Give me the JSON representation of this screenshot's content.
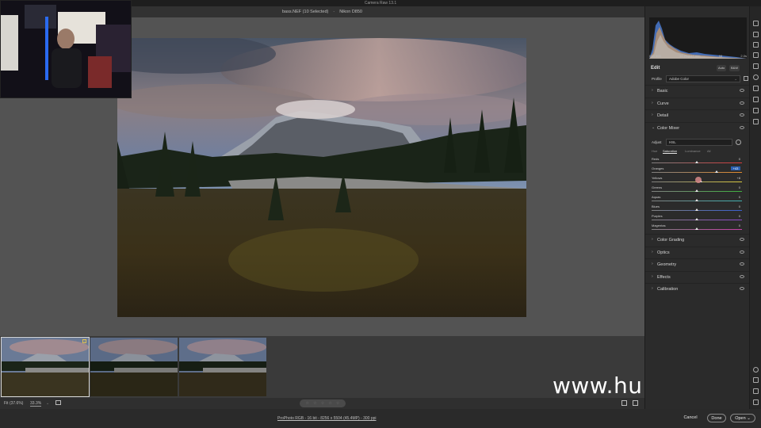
{
  "window": {
    "app_title": "Camera Raw 13.1",
    "file_name": "bass.NEF (10 Selected)",
    "camera": "Nikon D850"
  },
  "camera_info": {
    "iso": "ISO 500",
    "lens": "14-24@17 mm",
    "aperture": "f/8",
    "shutter": "2.0s"
  },
  "edit_panel": {
    "title": "Edit",
    "auto_label": "Auto",
    "bw_label": "B&W",
    "profile_label": "Profile",
    "profile_value": "Adobe Color"
  },
  "sections_top": [
    {
      "label": "Basic"
    },
    {
      "label": "Curve"
    },
    {
      "label": "Detail"
    },
    {
      "label": "Color Mixer"
    }
  ],
  "color_mixer": {
    "adjust_label": "Adjust",
    "adjust_value": "HSL",
    "tabs": [
      "Hue",
      "Saturation",
      "Luminance",
      "All"
    ],
    "active_tab": "Saturation",
    "sliders": [
      {
        "label": "Reds",
        "value": "0",
        "fraction": 0.5,
        "color_left": "#808080",
        "color_right": "#d23a3a"
      },
      {
        "label": "Oranges",
        "value": "+43",
        "fraction": 0.715,
        "color_left": "#808080",
        "color_right": "#e08a30",
        "editing": true
      },
      {
        "label": "Yellows",
        "value": "+8",
        "fraction": 0.54,
        "color_left": "#808080",
        "color_right": "#d8c840"
      },
      {
        "label": "Greens",
        "value": "0",
        "fraction": 0.5,
        "color_left": "#808080",
        "color_right": "#40b040"
      },
      {
        "label": "Aquas",
        "value": "0",
        "fraction": 0.5,
        "color_left": "#808080",
        "color_right": "#40b0b0"
      },
      {
        "label": "Blues",
        "value": "0",
        "fraction": 0.5,
        "color_left": "#808080",
        "color_right": "#3a60d0"
      },
      {
        "label": "Purples",
        "value": "0",
        "fraction": 0.5,
        "color_left": "#808080",
        "color_right": "#8a48c8"
      },
      {
        "label": "Magentas",
        "value": "0",
        "fraction": 0.5,
        "color_left": "#808080",
        "color_right": "#c840a8"
      }
    ]
  },
  "sections_bottom": [
    {
      "label": "Color Grading"
    },
    {
      "label": "Optics"
    },
    {
      "label": "Geometry"
    },
    {
      "label": "Effects"
    },
    {
      "label": "Calibration"
    }
  ],
  "bottom_bar": {
    "fit_label": "Fit (37.6%)",
    "zoom_label": "33.3%",
    "stars": [
      "☆",
      "☆",
      "☆",
      "☆",
      "☆"
    ]
  },
  "footer": {
    "workflow": "ProPhoto RGB - 16 bit - 8256 x 5504 (45.4MP) - 300 ppi",
    "cancel": "Cancel",
    "done": "Done",
    "open": "Open",
    "open_caret": "⌄"
  },
  "watermark": "www.hunls.com",
  "colors": {
    "accent": "#2a5fb0",
    "panel_bg": "#2b2b2b",
    "canvas_bg": "#535353"
  }
}
